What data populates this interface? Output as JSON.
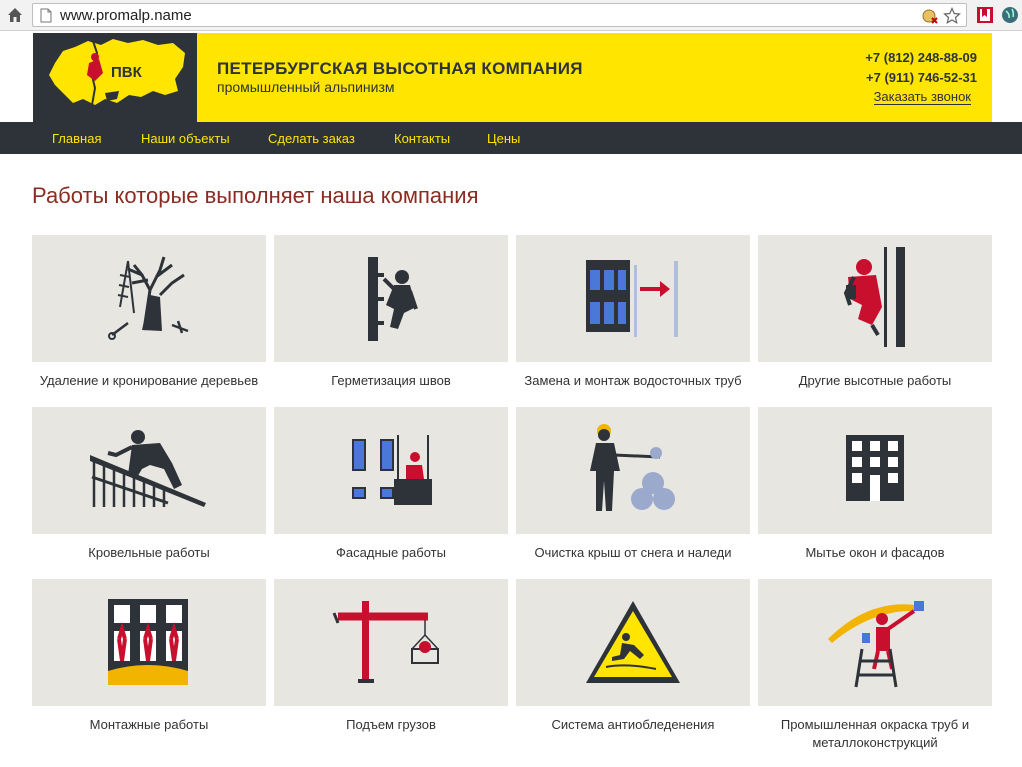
{
  "browser": {
    "url": "www.promalp.name"
  },
  "header": {
    "logo_text": "ПВК",
    "company_name": "ПЕТЕРБУРГСКАЯ ВЫСОТНАЯ КОМПАНИЯ",
    "company_sub": "промышленный альпинизм",
    "phone1": "+7 (812) 248-88-09",
    "phone2": "+7 (911) 746-52-31",
    "callback": "Заказать звонок"
  },
  "nav": {
    "items": [
      {
        "label": "Главная"
      },
      {
        "label": "Наши объекты"
      },
      {
        "label": "Сделать заказ"
      },
      {
        "label": "Контакты"
      },
      {
        "label": "Цены"
      }
    ]
  },
  "main": {
    "title": "Работы которые выполняет наша компания",
    "services": [
      {
        "label": "Удаление и кронирование деревьев",
        "icon": "tree-removal-icon"
      },
      {
        "label": "Герметизация швов",
        "icon": "seam-sealing-icon"
      },
      {
        "label": "Замена и монтаж водосточных труб",
        "icon": "drainpipe-icon"
      },
      {
        "label": "Другие высотные работы",
        "icon": "climber-icon"
      },
      {
        "label": "Кровельные работы",
        "icon": "roofing-icon"
      },
      {
        "label": "Фасадные работы",
        "icon": "facade-icon"
      },
      {
        "label": "Очистка крыш от снега и наледи",
        "icon": "snow-removal-icon"
      },
      {
        "label": "Мытье окон и фасадов",
        "icon": "window-washing-icon"
      },
      {
        "label": "Монтажные работы",
        "icon": "installation-icon"
      },
      {
        "label": "Подъем грузов",
        "icon": "crane-icon"
      },
      {
        "label": "Система антиобледенения",
        "icon": "anti-icing-icon"
      },
      {
        "label": "Промышленная окраска труб и металлоконструкций",
        "icon": "painting-icon"
      }
    ]
  },
  "colors": {
    "brand_yellow": "#ffe500",
    "brand_dark": "#2d3339",
    "accent_red": "#c8102e",
    "title_red": "#8b2c22",
    "tile_bg": "#e8e6e1"
  }
}
